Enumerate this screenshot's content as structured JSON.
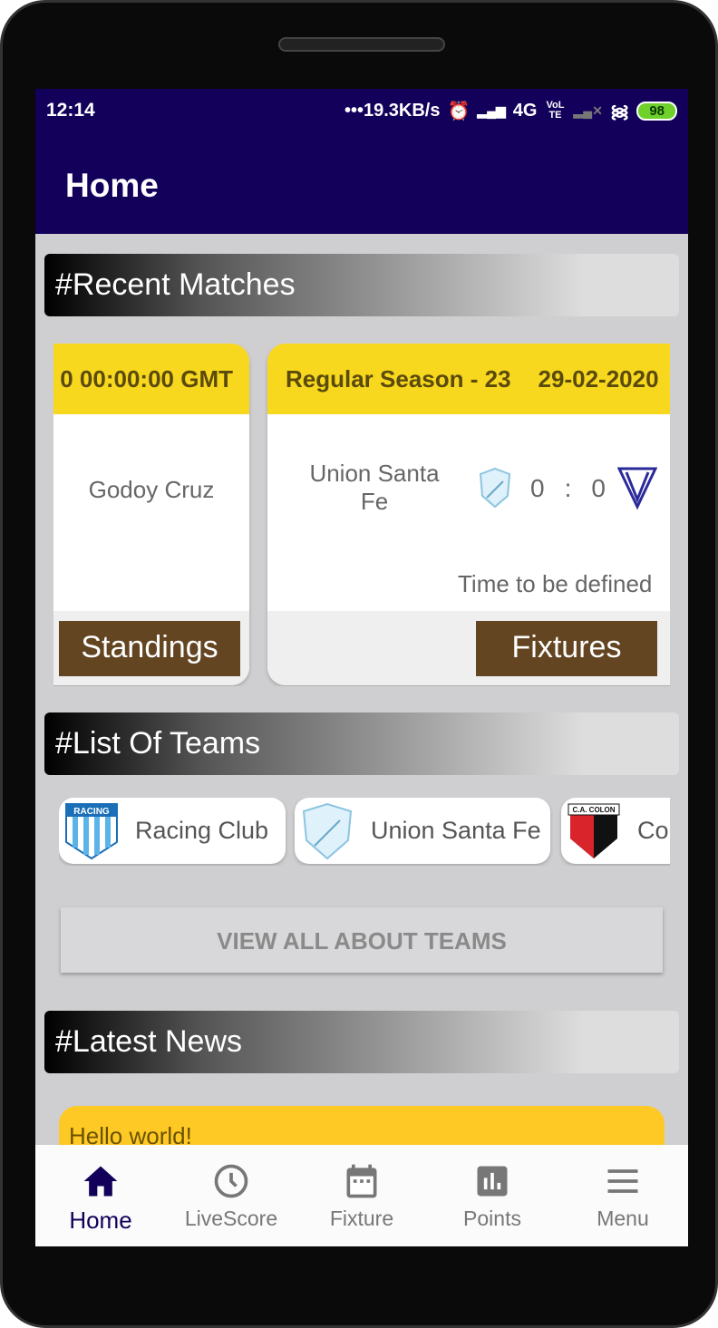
{
  "status_bar": {
    "time": "12:14",
    "network_speed": "•••19.3KB/s",
    "network": "4G",
    "volte": "VoLTE",
    "battery": "98"
  },
  "app_bar": {
    "title": "Home"
  },
  "sections": {
    "recent_matches": "#Recent Matches",
    "list_of_teams": "#List Of Teams",
    "latest_news": "#Latest News"
  },
  "matches": [
    {
      "header": "0 00:00:00 GMT",
      "home_team": "Godoy Cruz",
      "button": "Standings"
    },
    {
      "round": "Regular Season - 23",
      "date": "29-02-2020",
      "home_team": "Union Santa Fe",
      "home_score": "0",
      "separator": ":",
      "away_score": "0",
      "status": "Time to be defined",
      "button": "Fixtures"
    }
  ],
  "teams": [
    {
      "name": "Racing Club",
      "logo": "racing-club-logo"
    },
    {
      "name": "Union Santa Fe",
      "logo": "union-santa-fe-logo"
    },
    {
      "name": "Colon",
      "logo": "colon-logo"
    }
  ],
  "team_logo_text": {
    "racing": "RACING",
    "colon": "C.A. COLON"
  },
  "view_all_label": "VIEW ALL ABOUT TEAMS",
  "news": [
    {
      "title": "Hello world!"
    }
  ],
  "bottom_nav": [
    {
      "label": "Home",
      "icon": "home-icon",
      "active": true
    },
    {
      "label": "LiveScore",
      "icon": "clock-icon"
    },
    {
      "label": "Fixture",
      "icon": "calendar-icon"
    },
    {
      "label": "Points",
      "icon": "bar-chart-icon"
    },
    {
      "label": "Menu",
      "icon": "menu-icon"
    }
  ],
  "colors": {
    "primary": "#12005a",
    "card_header": "#f8d81e",
    "button": "#634522",
    "news": "#fec925"
  }
}
